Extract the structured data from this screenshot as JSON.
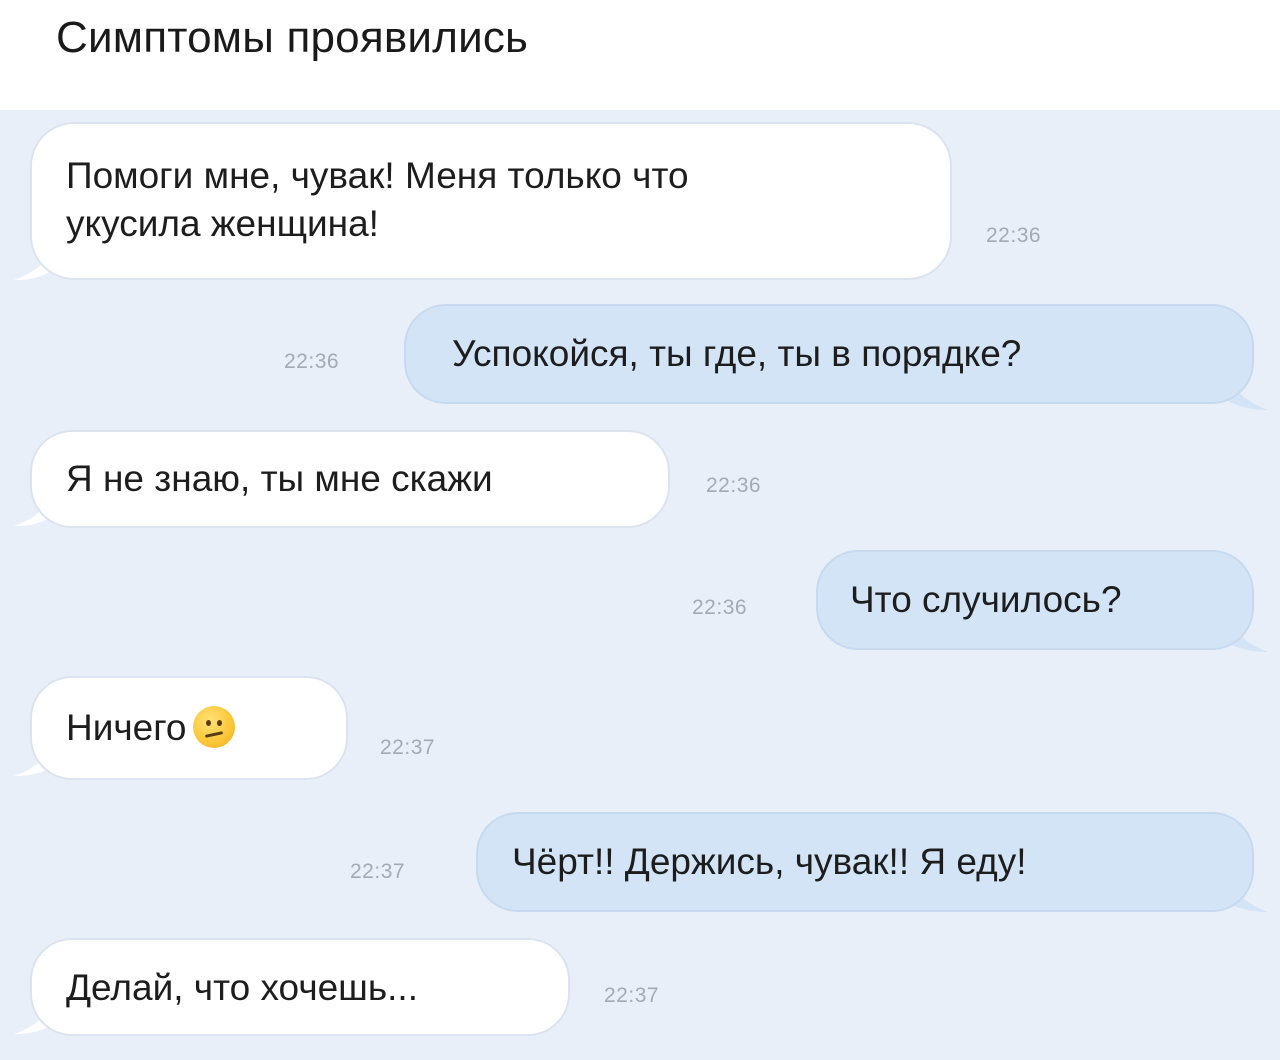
{
  "title": "Симптомы проявились",
  "messages": [
    {
      "side": "in",
      "lines": [
        "Помоги мне, чувак! Меня только что",
        "укусила женщина!"
      ],
      "time": "22:36"
    },
    {
      "side": "out",
      "text": "Успокойся, ты где, ты в порядке?",
      "time": "22:36"
    },
    {
      "side": "in",
      "text": "Я не знаю, ты мне скажи",
      "time": "22:36"
    },
    {
      "side": "out",
      "text": "Что случилось?",
      "time": "22:36"
    },
    {
      "side": "in",
      "text": "Ничего",
      "emoji": "confused-face-emoji",
      "time": "22:37"
    },
    {
      "side": "out",
      "text": "Чёрт!! Держись, чувак!! Я еду!",
      "time": "22:37"
    },
    {
      "side": "in",
      "text": "Делай, что хочешь...",
      "time": "22:37"
    }
  ],
  "colors": {
    "chat_background": "#e8eff8",
    "incoming_bubble": "#ffffff",
    "outgoing_bubble": "#d3e4f7",
    "timestamp": "#a3aab4"
  }
}
